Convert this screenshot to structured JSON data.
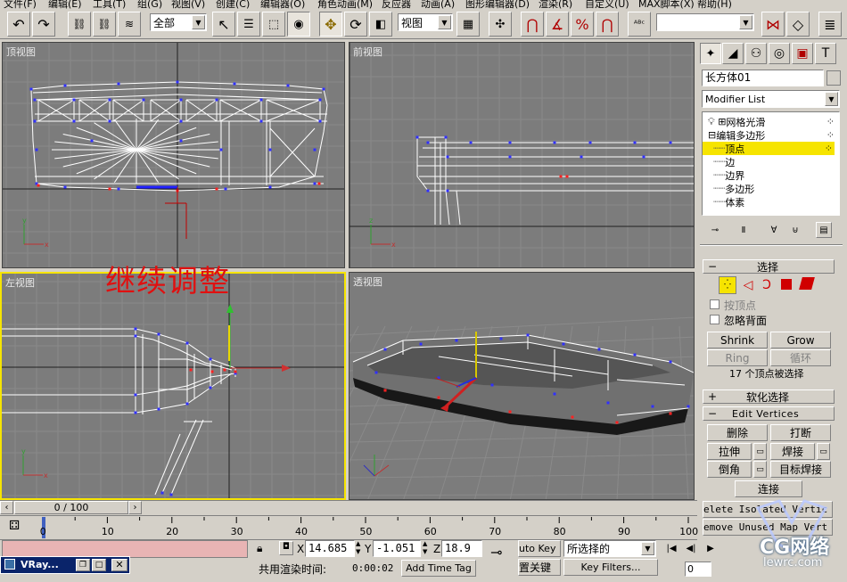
{
  "menu": {
    "items": [
      "文件(F)",
      "编辑(E)",
      "工具(T)",
      "组(G)",
      "视图(V)",
      "创建(C)",
      "编辑器(O)",
      "角色动画(M)",
      "反应器",
      "动画(A)",
      "图形编辑器(D)",
      "渲染(R)",
      "自定义(U)",
      "MAX脚本(X)",
      "帮助(H)"
    ]
  },
  "toolbar": {
    "undo_icon": "undo-icon",
    "redo_icon": "redo-icon",
    "selection_filter": "全部",
    "reference_coord": "视图",
    "named_selection": ""
  },
  "viewports": {
    "top": {
      "label": "顶视图"
    },
    "front": {
      "label": "前视图"
    },
    "left": {
      "label": "左视图",
      "annotation": "继续调整"
    },
    "perspective": {
      "label": "透视图"
    }
  },
  "command_panel": {
    "object_name": "长方体01",
    "modifier_list": "Modifier List",
    "stack": [
      {
        "label": "网格光滑",
        "level": 0
      },
      {
        "label": "编辑多边形",
        "level": 0
      },
      {
        "label": "顶点",
        "level": 1,
        "selected": true
      },
      {
        "label": "边",
        "level": 1
      },
      {
        "label": "边界",
        "level": 1
      },
      {
        "label": "多边形",
        "level": 1
      },
      {
        "label": "体素",
        "level": 1
      }
    ],
    "selection_rollout": {
      "title": "选择",
      "by_vertex": "按顶点",
      "ignore_backfacing": "忽略背面",
      "shrink": "Shrink",
      "grow": "Grow",
      "ring": "Ring",
      "loop": "循环",
      "status": "17 个顶点被选择"
    },
    "soft_selection": {
      "title": "软化选择"
    },
    "edit_vertices": {
      "title": "Edit Vertices",
      "remove": "删除",
      "break": "打断",
      "extrude": "拉伸",
      "weld": "焊接",
      "chamfer": "倒角",
      "target_weld": "目标焊接",
      "connect": "连接",
      "remove_isolated": "elete Isolated Vertic",
      "remove_unused": "emove Unused Map Vert"
    }
  },
  "timeline": {
    "frame_counter": "0 / 100",
    "ticks": [
      "0",
      "10",
      "20",
      "30",
      "40",
      "50",
      "60",
      "70",
      "80",
      "90",
      "100"
    ]
  },
  "status": {
    "x_value": "14.685",
    "y_value": "-1.051",
    "z_value": "18.9",
    "x_label": "X",
    "y_label": "Y",
    "z_label": "Z",
    "render_time_label": "共用渲染时间:",
    "render_time": "0:00:02",
    "add_time_tag": "Add Time Tag",
    "auto_key": "uto Key",
    "set_key": "置关键",
    "selected": "所选择的",
    "key_filters": "Key Filters...",
    "frame_field": "0"
  },
  "taskbar": {
    "item": "VRay..."
  },
  "watermark": {
    "line1": "CG网络",
    "line2": "lewrc.com"
  },
  "colors": {
    "viewport_bg": "#7c7c7c",
    "grid": "#6a6a6a",
    "wire": "#ffffff",
    "vertex": "#3030ff",
    "selected_vertex": "#ff2020",
    "active_border": "#f6e400",
    "annotation": "#e01010",
    "stack_highlight": "#f6e400"
  }
}
